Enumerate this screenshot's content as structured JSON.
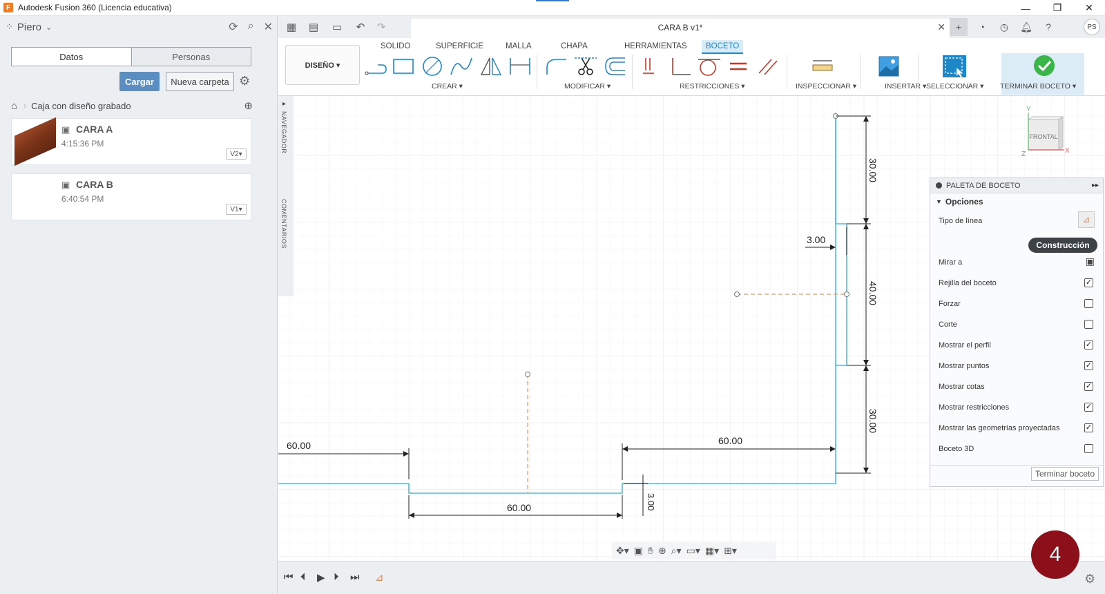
{
  "window": {
    "title": "Autodesk Fusion 360 (Licencia educativa)",
    "controls": [
      "—",
      "❐",
      "✕"
    ]
  },
  "data_panel": {
    "user": "Piero",
    "tabs": [
      "Datos",
      "Personas"
    ],
    "upload_label": "Cargar",
    "new_folder_label": "Nueva carpeta",
    "breadcrumb_folder": "Caja con diseño grabado",
    "files": [
      {
        "name": "CARA A",
        "time": "4:15:36 PM",
        "version": "V2▾"
      },
      {
        "name": "CARA B",
        "time": "6:40:54 PM",
        "version": "V1▾"
      }
    ]
  },
  "document": {
    "tab_name": "CARA B v1*",
    "avatar_initials": "PS"
  },
  "ribbon": {
    "workspace": "DISEÑO ▾",
    "tabs": [
      "SOLIDO",
      "SUPERFICIE",
      "MALLA",
      "CHAPA",
      "HERRAMIENTAS",
      "BOCETO"
    ],
    "active_tab": "BOCETO",
    "groups": {
      "crear": "CREAR ▾",
      "modificar": "MODIFICAR ▾",
      "restricciones": "RESTRICCIONES ▾",
      "inspeccionar": "INSPECCIONAR ▾",
      "insertar": "INSERTAR ▾",
      "seleccionar": "SELECCIONAR ▾",
      "terminar": "TERMINAR BOCETO ▾"
    }
  },
  "side_strip": {
    "navigator": "NAVEGADOR",
    "comments": "COMENTARIOS"
  },
  "view_cube": {
    "face": "FRONTAL",
    "axis_x": "X",
    "axis_y": "Y",
    "axis_z": "Z"
  },
  "sketch": {
    "dimensions": {
      "d_left_60": "60.00",
      "d_bottom_60": "60.00",
      "d_right_60": "60.00",
      "d_3_horizontal": "3.00",
      "d_3_vertical": "3.00",
      "d_30_top": "30.00",
      "d_40_mid": "40.00",
      "d_30_bottom": "30.00"
    },
    "colors": {
      "profile_line": "#5bb6d6",
      "construction_line": "#e0a978",
      "dimension": "#222222"
    }
  },
  "palette": {
    "title": "PALETA DE BOCETO",
    "section": "Opciones",
    "line_type_label": "Tipo de línea",
    "line_type_value": "Construcción",
    "look_at": "Mirar a",
    "options": [
      {
        "label": "Rejilla del boceto",
        "checked": true
      },
      {
        "label": "Forzar",
        "checked": false
      },
      {
        "label": "Corte",
        "checked": false
      },
      {
        "label": "Mostrar el perfil",
        "checked": true
      },
      {
        "label": "Mostrar puntos",
        "checked": true
      },
      {
        "label": "Mostrar cotas",
        "checked": true
      },
      {
        "label": "Mostrar restricciones",
        "checked": true
      },
      {
        "label": "Mostrar las geometrías proyectadas",
        "checked": true
      },
      {
        "label": "Boceto 3D",
        "checked": false
      }
    ],
    "finish_button": "Terminar boceto"
  },
  "overlay": {
    "step_number": "4"
  }
}
